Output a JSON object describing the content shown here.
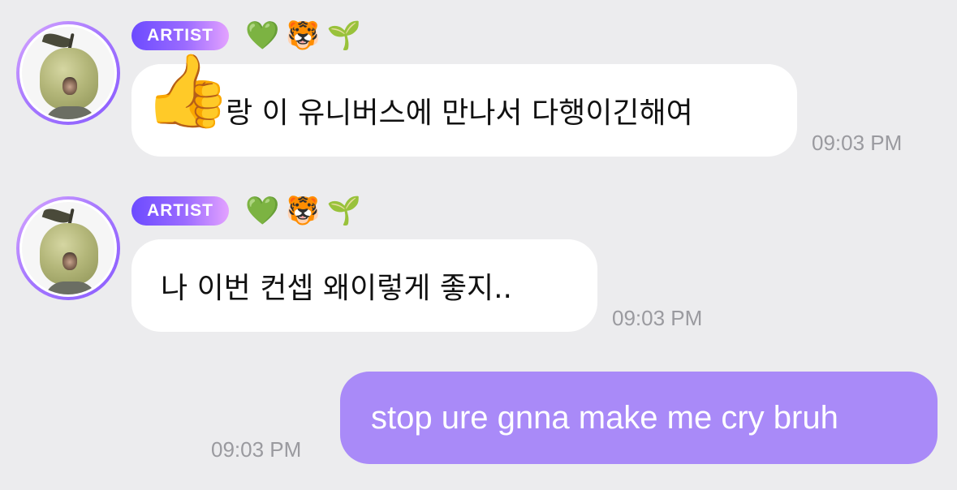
{
  "messages": [
    {
      "badge": "ARTIST",
      "emojis": [
        "💚",
        "🐯",
        "🌱"
      ],
      "prefix_emoji": "👍",
      "text": "랑 이 유니버스에 만나서 다행이긴해여",
      "time": "09:03 PM"
    },
    {
      "badge": "ARTIST",
      "emojis": [
        "💚",
        "🐯",
        "🌱"
      ],
      "text": "나 이번 컨셉 왜이렇게 좋지..",
      "time": "09:03 PM"
    },
    {
      "text": "stop ure gnna make me cry bruh",
      "time": "09:03 PM"
    }
  ],
  "colors": {
    "background": "#ececee",
    "received_bubble": "#ffffff",
    "sent_bubble": "#a98af8",
    "badge_gradient_start": "#6c4bff",
    "badge_gradient_end": "#e3a2ff",
    "timestamp": "#9a9a9f"
  },
  "icons": {
    "avatar": "apple-head-avatar",
    "emoji_1": "green-heart-icon",
    "emoji_2": "tiger-face-icon",
    "emoji_3": "seedling-icon",
    "thumb": "thumbs-up-icon"
  }
}
